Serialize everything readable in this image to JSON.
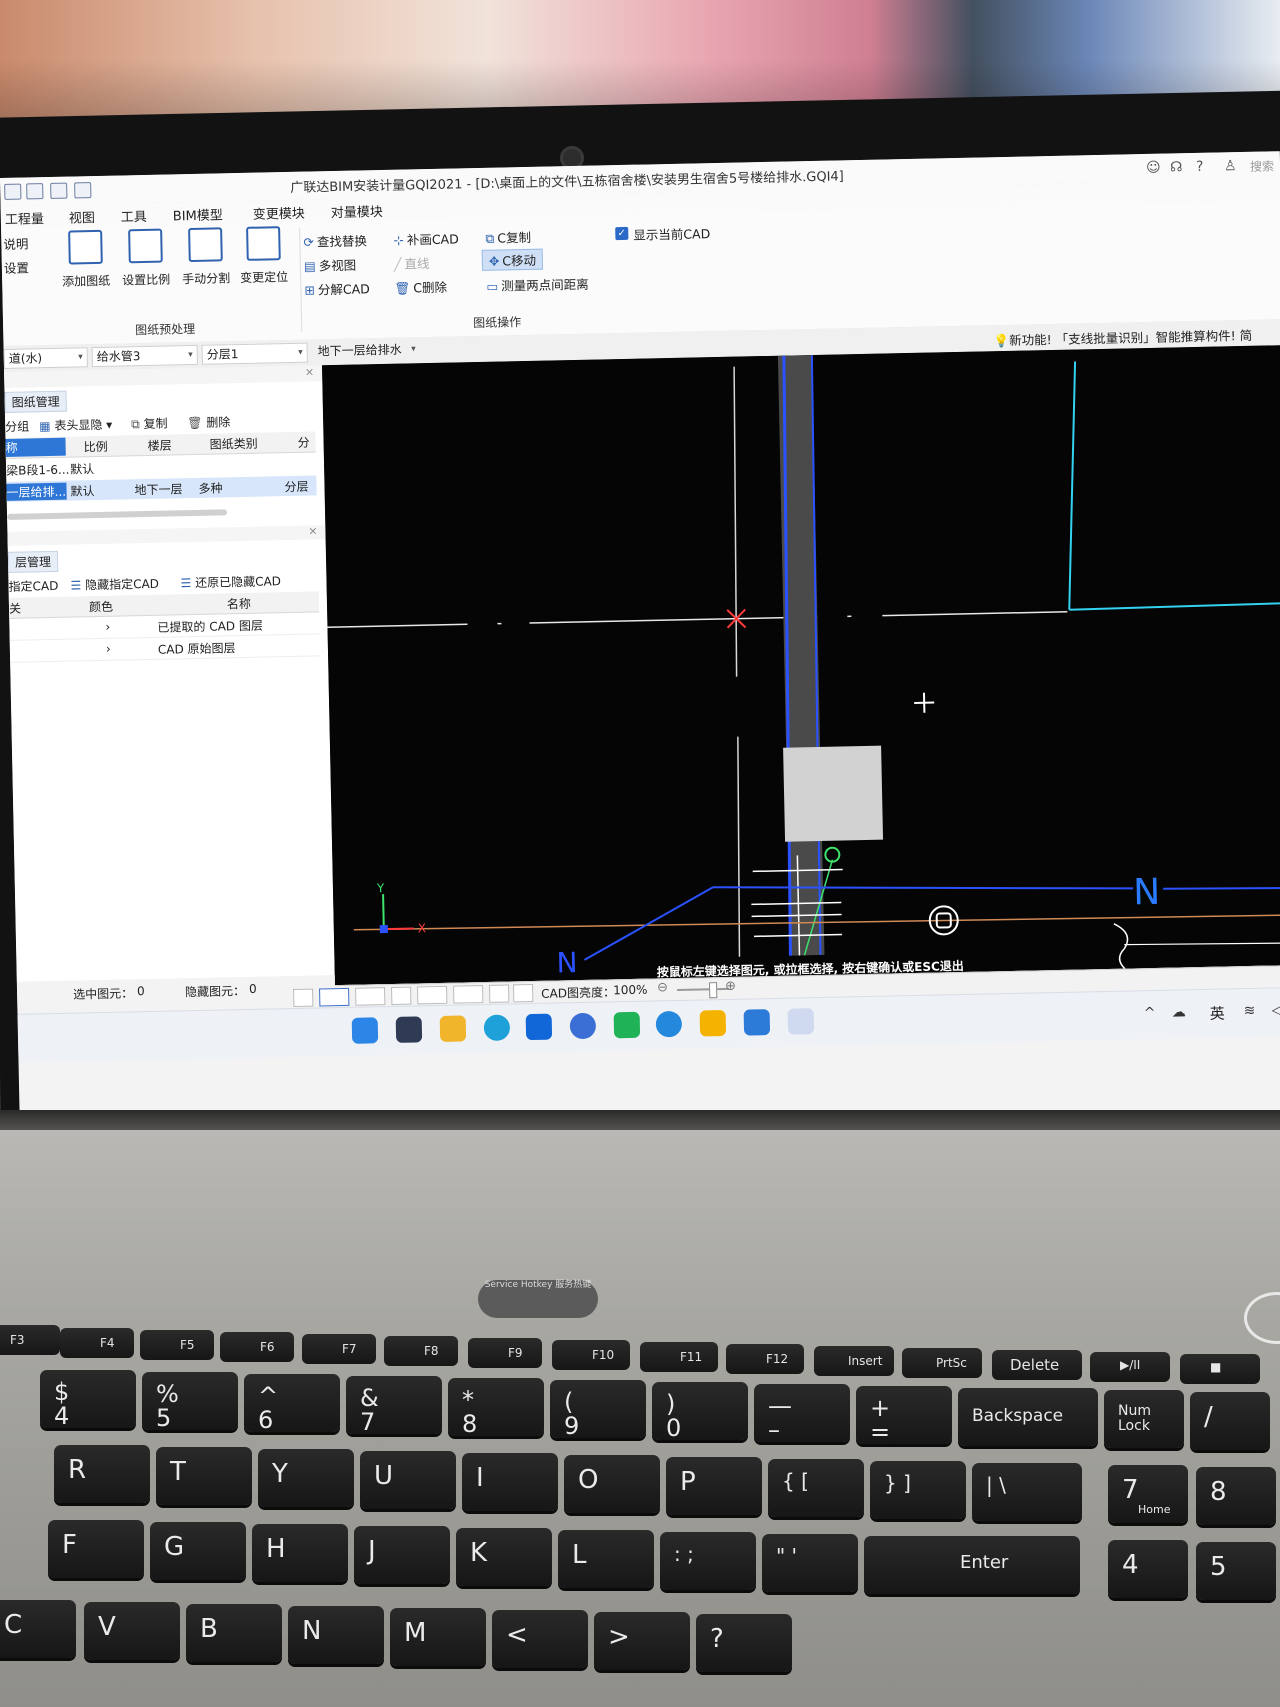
{
  "window": {
    "title": "广联达BIM安装计量GQI2021 - [D:\\桌面上的文件\\五栋宿舍楼\\安装男生宿舍5号楼给排水.GQI4]",
    "search_placeholder": "搜索"
  },
  "menu": [
    "工程量",
    "视图",
    "工具",
    "BIM模型",
    "变更模块",
    "对量模块"
  ],
  "ribbon": {
    "left_items": [
      "说明",
      "设置"
    ],
    "big_buttons": [
      "添加图纸",
      "设置比例",
      "手动分割",
      "变更定位"
    ],
    "group1_label": "图纸预处理",
    "col1": [
      "查找替换",
      "多视图",
      "分解CAD"
    ],
    "col2": [
      "补画CAD",
      "直线",
      "C删除"
    ],
    "col3": [
      "C复制",
      "C移动",
      "测量两点间距离"
    ],
    "group2_label": "图纸操作",
    "show_cad_label": "显示当前CAD"
  },
  "toolbar2": {
    "combo1": "道(水)",
    "combo2": "给水管3",
    "combo3": "分层1",
    "combo4": "地下一层给排水",
    "news_prefix": "新功能!",
    "news_text": "「支线批量识别」智能推算构件! 简"
  },
  "drawing_panel": {
    "tab": "图纸管理",
    "tools": [
      "分组",
      "表头显隐",
      "复制",
      "删除"
    ],
    "headers": [
      "称",
      "比例",
      "楼层",
      "图纸类别",
      "分"
    ],
    "rows": [
      [
        "梁B段1-6...",
        "默认",
        "",
        "",
        ""
      ],
      [
        "一层给排...",
        "默认",
        "地下一层",
        "多种",
        "分层"
      ]
    ]
  },
  "layer_panel": {
    "tab": "层管理",
    "tools": [
      "指定CAD",
      "隐藏指定CAD",
      "还原已隐藏CAD"
    ],
    "headers": [
      "关",
      "颜色",
      "名称"
    ],
    "rows": [
      "已提取的 CAD 图层",
      "CAD 原始图层"
    ]
  },
  "status": {
    "selected_label": "选中图元：",
    "selected_count": "0",
    "hidden_label": "隐藏图元：",
    "hidden_count": "0",
    "brightness_label": "CAD图亮度：",
    "brightness_value": "100%",
    "hint": "按鼠标左键选择图元, 或拉框选择, 按右键确认或ESC退出"
  },
  "canvas": {
    "axis_x": "X",
    "axis_y": "Y",
    "north_label": "N",
    "colors": {
      "background": "#050505",
      "blue_line": "#2b52ff",
      "cyan_line": "#33d2f0",
      "cursor_x": "#ff3a3a",
      "orange_line": "#d08a55"
    }
  },
  "taskbar": {
    "tray_lang": "英"
  },
  "keyboard": {
    "fkeys": [
      "F3",
      "F4",
      "F5",
      "F6",
      "F7",
      "F8",
      "F9",
      "F10",
      "F11",
      "F12",
      "Insert",
      "PrtSc",
      "Delete",
      "▶/II",
      "■"
    ],
    "number_row": [
      "$\n4",
      "%\n5",
      "^\n6",
      "&\n7",
      "*\n8",
      "(\n9",
      ")\n0",
      "—\n–",
      "+\n="
    ],
    "backspace": "Backspace",
    "numlock": "Num Lock",
    "row_qwerty": [
      "R",
      "T",
      "Y",
      "U",
      "I",
      "O",
      "P",
      "{ [",
      "} ]",
      "| \\"
    ],
    "row_asdf": [
      "F",
      "G",
      "H",
      "J",
      "K",
      "L",
      ": ;",
      "\" '"
    ],
    "enter": "Enter",
    "row_zxcv": [
      "C",
      "V",
      "B",
      "N",
      "M",
      "<",
      ">",
      "?"
    ],
    "numpad": [
      "7",
      "8",
      "4",
      "5",
      "Home"
    ],
    "logo_text": "Service Hotkey 服务热键"
  }
}
